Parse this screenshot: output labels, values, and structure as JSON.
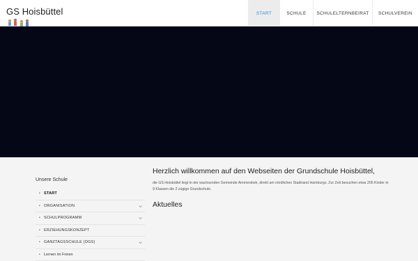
{
  "header": {
    "site_title": "GS Hoisbüttel",
    "logo_icon": "children-figures-icon",
    "nav": [
      {
        "label": "START",
        "active": true
      },
      {
        "label": "SCHULE",
        "active": false
      },
      {
        "label": "SCHULELTERNBEIRAT",
        "active": false
      },
      {
        "label": "SCHULVEREIN",
        "active": false
      }
    ],
    "accent_color": "#2b8bd8"
  },
  "hero": {
    "background_color": "#050716"
  },
  "sidebar": {
    "title": "Unsere Schule",
    "items": [
      {
        "label": "START",
        "active": true,
        "has_submenu": false
      },
      {
        "label": "ORGANISATION",
        "active": false,
        "has_submenu": true
      },
      {
        "label": "SCHULPROGRAMM",
        "active": false,
        "has_submenu": true
      },
      {
        "label": "ERZIEHUNGSKONZEPT",
        "active": false,
        "has_submenu": false
      },
      {
        "label": "GANZTAGSSCHULE (OGS)",
        "active": false,
        "has_submenu": true
      },
      {
        "label": "Lernen im Freien",
        "active": false,
        "has_submenu": false
      }
    ]
  },
  "main": {
    "welcome_title": "Herzlich willkommen auf den Webseiten der Grundschule Hoisbüttel,",
    "intro": "die GS Hoisbüttel liegt in der wachsenden Gemeinde Ammersbek, direkt am nördlichen Stadtrand Hamburgs. Zur Zeit besuchen etwa 205 Kinder in 9 Klassen die 2 zügige Grundschule.",
    "section_title": "Aktuelles"
  }
}
